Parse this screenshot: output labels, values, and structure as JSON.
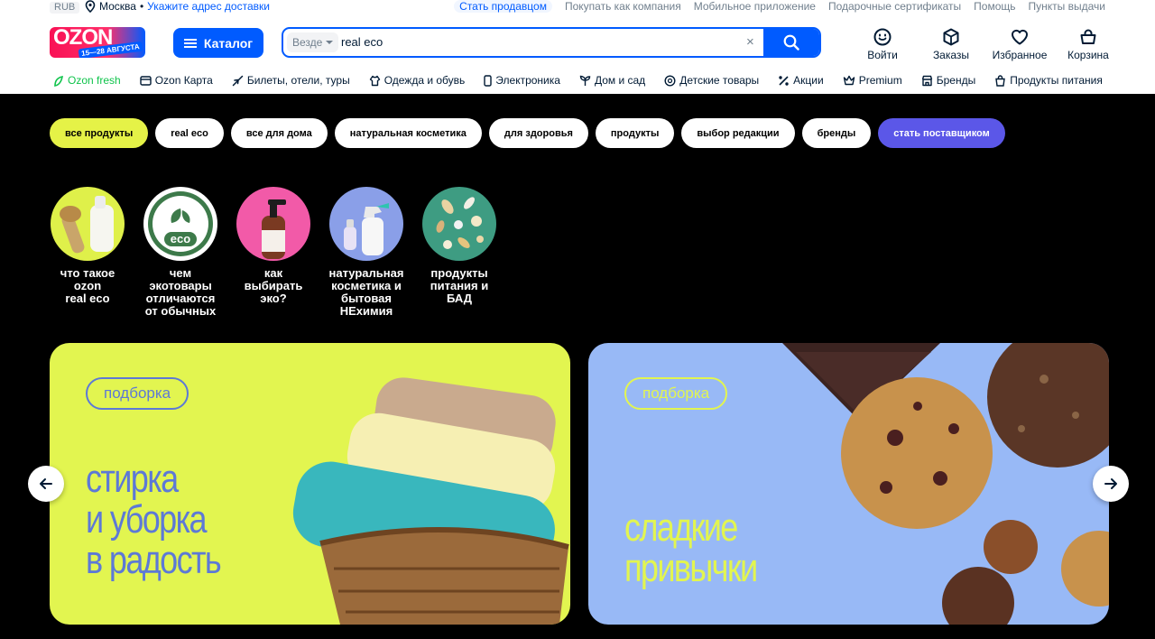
{
  "topbar": {
    "currency": "RUB",
    "city": "Москва",
    "separator": "•",
    "address_link": "Укажите адрес доставки",
    "links": [
      "Стать продавцом",
      "Покупать как компания",
      "Мобильное приложение",
      "Подарочные сертификаты",
      "Помощь",
      "Пункты выдачи"
    ]
  },
  "logo": {
    "word": "OZON",
    "dates": "15—28 АВГУСТА"
  },
  "catalog": {
    "label": "Каталог"
  },
  "search": {
    "scope": "Везде",
    "query": "real eco",
    "clear_glyph": "×"
  },
  "actions": [
    "Войти",
    "Заказы",
    "Избранное",
    "Корзина"
  ],
  "nav": [
    "Ozon fresh",
    "Ozon Карта",
    "Билеты, отели, туры",
    "Одежда и обувь",
    "Электроника",
    "Дом и сад",
    "Детские товары",
    "Акции",
    "Premium",
    "Бренды",
    "Продукты питания"
  ],
  "pills": [
    "все продукты",
    "real eco",
    "все для дома",
    "натуральная косметика",
    "для здоровья",
    "продукты",
    "выбор редакции",
    "бренды",
    "стать поставщиком"
  ],
  "stories": [
    {
      "line1": "что такое",
      "line2": "ozon",
      "line3": "real eco",
      "line4": ""
    },
    {
      "line1": "чем",
      "line2": "экотовары",
      "line3": "отличаются",
      "line4": "от обычных"
    },
    {
      "line1": "как",
      "line2": "выбирать",
      "line3": "эко?",
      "line4": ""
    },
    {
      "line1": "натуральная",
      "line2": "косметика и",
      "line3": "бытовая",
      "line4": "НЕхимия"
    },
    {
      "line1": "продукты",
      "line2": "питания и",
      "line3": "БАД",
      "line4": ""
    }
  ],
  "eco_badge": "eco",
  "banners": [
    {
      "tag": "подборка",
      "line1": "стирка",
      "line2": "и уборка",
      "line3": "в радость"
    },
    {
      "tag": "подборка",
      "line1": "сладкие",
      "line2": "привычки",
      "line3": ""
    }
  ],
  "colors": {
    "brand_blue": "#005bff",
    "pill_active": "#e5f247",
    "pill_cta": "#5b57e8",
    "banner1_bg": "#e2f550",
    "banner1_text": "#5d79d6",
    "banner2_bg": "#98b9f6",
    "banner2_text": "#e2f550"
  }
}
